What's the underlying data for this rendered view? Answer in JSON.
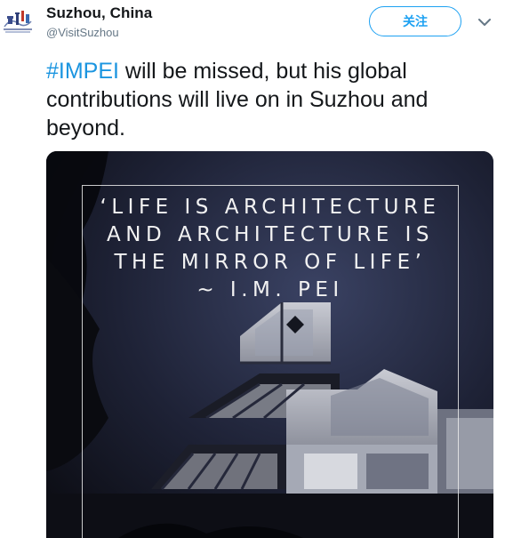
{
  "account": {
    "display_name": "Suzhou, China",
    "handle": "@VisitSuzhou",
    "avatar_icon": "suzhou-pagoda-logo-icon"
  },
  "actions": {
    "follow_label": "关注",
    "more_icon": "chevron-down-icon"
  },
  "tweet": {
    "hashtag": "#IMPEI",
    "text_rest": " will be missed, but his global contributions will live on in Suzhou and beyond."
  },
  "media": {
    "quote_lines": [
      "‘LIFE IS ARCHITECTURE",
      "AND ARCHITECTURE IS",
      "THE MIRROR OF LIFE’",
      "~ I.M. PEI"
    ]
  },
  "colors": {
    "accent": "#1da1f2",
    "hashtag": "#1b95e0",
    "text": "#14171a",
    "muted": "#657786"
  }
}
